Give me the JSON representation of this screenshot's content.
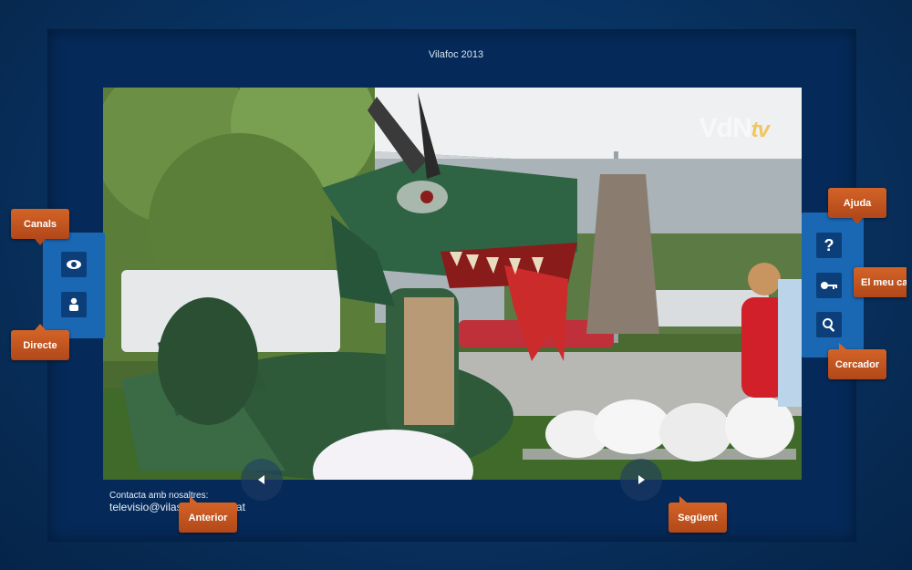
{
  "page": {
    "title": "Vilafoc 2013"
  },
  "brand": {
    "logo_main": "VdN",
    "logo_tv": "tv"
  },
  "contact": {
    "label": "Contacta amb nosaltres:",
    "email": "televisio@vilassardemar.cat"
  },
  "left_panel": {
    "channels_label": "Canals",
    "live_label": "Directe",
    "icons": [
      "eye-icon",
      "person-icon"
    ]
  },
  "right_panel": {
    "help_label": "Ajuda",
    "my_channel_label": "El meu canal",
    "search_label": "Cercador",
    "icons": [
      "help-icon",
      "key-icon",
      "search-icon"
    ]
  },
  "navigation": {
    "prev_label": "Anterior",
    "next_label": "Següent"
  },
  "colors": {
    "accent": "#c8561e",
    "panel": "#1a67b3",
    "background": "#062a58"
  }
}
